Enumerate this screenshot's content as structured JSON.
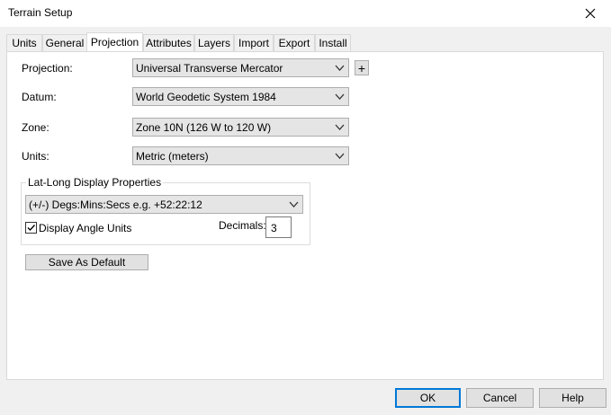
{
  "window": {
    "title": "Terrain Setup"
  },
  "tabs": [
    {
      "label": "Units"
    },
    {
      "label": "General"
    },
    {
      "label": "Projection"
    },
    {
      "label": "Attributes"
    },
    {
      "label": "Layers"
    },
    {
      "label": "Import"
    },
    {
      "label": "Export"
    },
    {
      "label": "Install"
    }
  ],
  "active_tab": "Projection",
  "projection": {
    "label": "Projection:",
    "value": "Universal Transverse Mercator",
    "add_label": "+"
  },
  "datum": {
    "label": "Datum:",
    "value": "World Geodetic System 1984"
  },
  "zone": {
    "label": "Zone:",
    "value": "Zone 10N (126 W to 120 W)"
  },
  "units": {
    "label": "Units:",
    "value": "Metric (meters)"
  },
  "latlong": {
    "group_title": "Lat-Long Display Properties",
    "format_value": "(+/-) Degs:Mins:Secs e.g.  +52:22:12",
    "display_angle_label": "Display Angle Units",
    "display_angle_checked": true,
    "decimals_label": "Decimals:",
    "decimals_value": "3"
  },
  "save_default_label": "Save As Default",
  "footer": {
    "ok_label": "OK",
    "cancel_label": "Cancel",
    "help_label": "Help"
  },
  "icons": {
    "close": "close-icon",
    "dropdown": "chevron-down-icon",
    "check": "check-icon"
  },
  "colors": {
    "window_bg": "#f0f0f0",
    "panel_bg": "#ffffff",
    "button_bg": "#e1e1e1",
    "default_button_border": "#0078d7"
  }
}
